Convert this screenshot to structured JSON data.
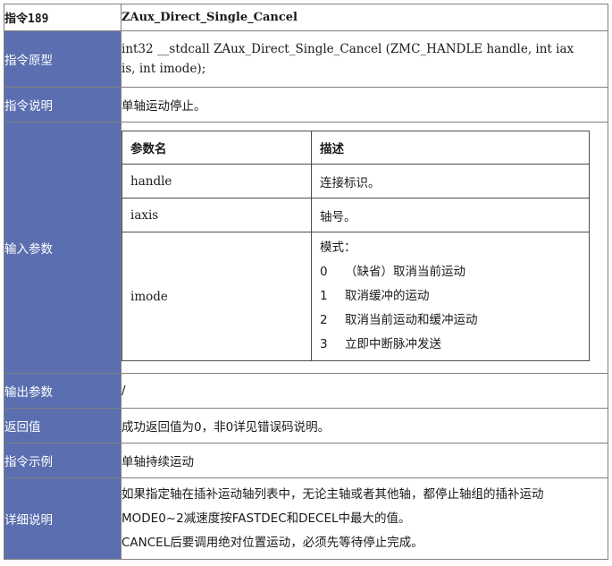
{
  "header": {
    "instr": "指令189",
    "name": "ZAux_Direct_Single_Cancel"
  },
  "rows": {
    "proto": {
      "label": "指令原型",
      "line1": "int32 __stdcall ZAux_Direct_Single_Cancel (ZMC_HANDLE handle, int iax",
      "line2": "is, int imode);"
    },
    "desc": {
      "label": "指令说明",
      "value": "单轴运动停止。"
    },
    "input": {
      "label": "输入参数",
      "col_param": "参数名",
      "col_desc": "描述",
      "params": [
        {
          "name": "handle",
          "desc": "连接标识。"
        },
        {
          "name": "iaxis",
          "desc": "轴号。"
        },
        {
          "name": "imode",
          "desc": "模式："
        }
      ],
      "modes": [
        {
          "num": "0",
          "text": "（缺省）取消当前运动"
        },
        {
          "num": "1",
          "text": "取消缓冲的运动"
        },
        {
          "num": "2",
          "text": "取消当前运动和缓冲运动"
        },
        {
          "num": "3",
          "text": "立即中断脉冲发送"
        }
      ]
    },
    "output": {
      "label": "输出参数",
      "value": "/"
    },
    "ret": {
      "label": "返回值",
      "value": "成功返回值为0，非0详见错误码说明。"
    },
    "example": {
      "label": "指令示例",
      "value": "单轴持续运动"
    },
    "detail": {
      "label": "详细说明",
      "line1": "如果指定轴在插补运动轴列表中，无论主轴或者其他轴，都停止轴组的插补运动",
      "line2": "MODE0~2减速度按FASTDEC和DECEL中最大的值。",
      "line3": "CANCEL后要调用绝对位置运动，必须先等待停止完成。"
    }
  }
}
